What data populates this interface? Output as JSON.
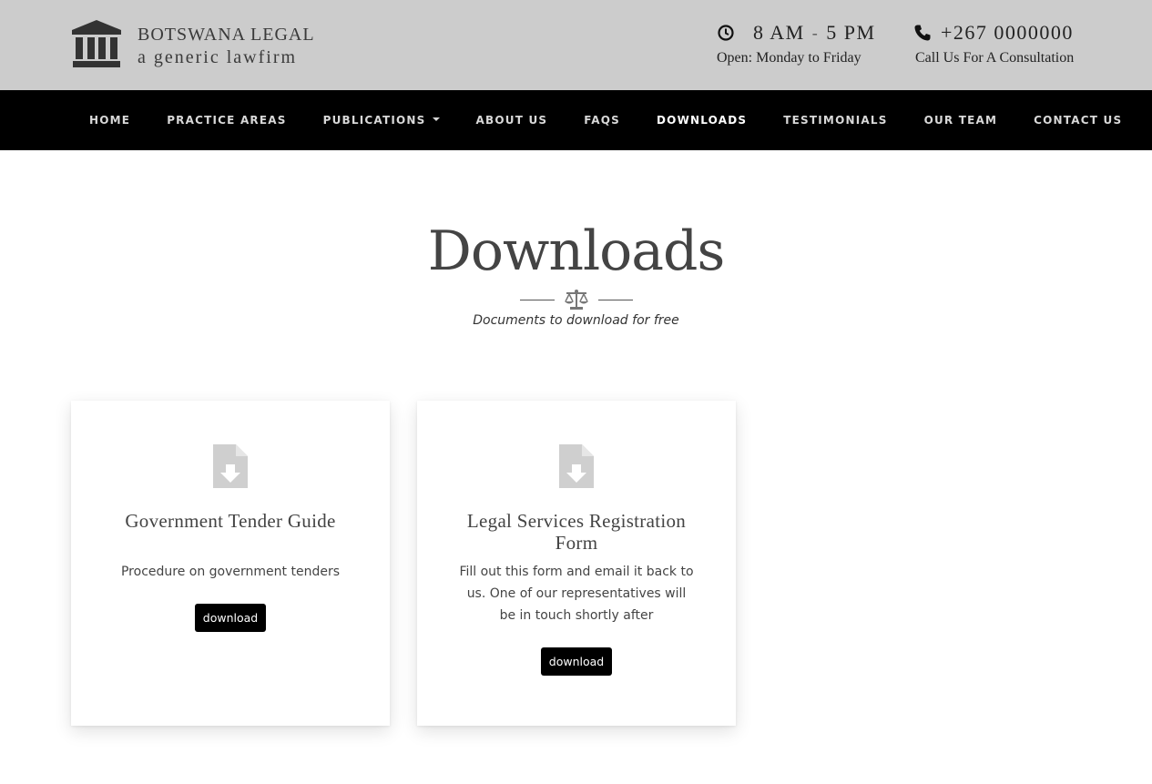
{
  "header": {
    "brand_line1": "BOTSWANA LEGAL",
    "brand_line2": "a generic lawfirm",
    "hours": {
      "start": "8 AM",
      "separator": "-",
      "end": "5 PM",
      "subtitle": "Open: Monday to Friday",
      "icon": "clock-icon"
    },
    "phone": {
      "number": "+267 0000000",
      "subtitle": "Call Us For A Consultation",
      "icon": "phone-icon"
    }
  },
  "nav": {
    "items": [
      {
        "label": "HOME"
      },
      {
        "label": "PRACTICE AREAS"
      },
      {
        "label": "PUBLICATIONS"
      },
      {
        "label": "ABOUT US"
      },
      {
        "label": "FAQS"
      },
      {
        "label": "DOWNLOADS",
        "active": true
      },
      {
        "label": "TESTIMONIALS"
      },
      {
        "label": "OUR TEAM"
      },
      {
        "label": "CONTACT US"
      }
    ]
  },
  "page": {
    "title": "Downloads",
    "subtitle": "Documents to download for free",
    "divider_icon": "scales-icon"
  },
  "cards": [
    {
      "title": "Government Tender Guide",
      "description": "Procedure on government tenders",
      "button": "download",
      "icon": "file-download-icon"
    },
    {
      "title": "Legal Services Registration Form",
      "description": "Fill out this form and email it back to us. One of our representatives will be in touch shortly after",
      "button": "download",
      "icon": "file-download-icon"
    }
  ],
  "colors": {
    "topbar_bg": "#cccccc",
    "nav_bg": "#000000",
    "button_bg": "#000000",
    "icon_gray": "#cfcfcf"
  }
}
